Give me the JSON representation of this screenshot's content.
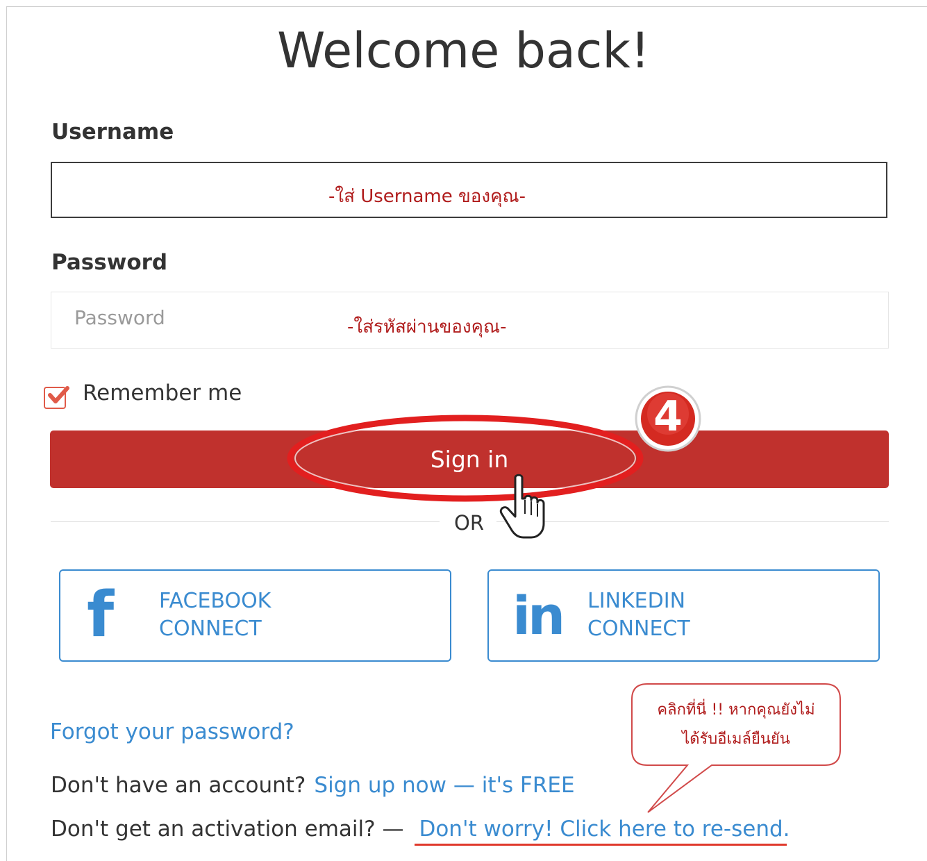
{
  "header": {
    "title": "Welcome back!"
  },
  "form": {
    "username_label": "Username",
    "username_note": "-ใส่ Username ของคุณ-",
    "password_label": "Password",
    "password_placeholder": "Password",
    "password_note": "-ใส่รหัสผ่านของคุณ-",
    "remember_label": "Remember me",
    "remember_checked": true,
    "signin_label": "Sign in",
    "or_label": "OR"
  },
  "social": {
    "facebook": {
      "icon": "facebook-icon",
      "line1": "FACEBOOK",
      "line2": "CONNECT"
    },
    "linkedin": {
      "icon": "linkedin-icon",
      "line1": "LINKEDIN",
      "line2": "CONNECT"
    }
  },
  "links": {
    "forgot": "Forgot your password?",
    "signup_prompt": "Don't have an account?",
    "signup_link": "Sign up now — it's FREE",
    "activation_prompt": "Don't get an activation email? —",
    "activation_link": "Don't worry! Click here to re-send."
  },
  "annotation": {
    "step_badge": "4",
    "bubble_line1": "คลิกที่นี่ !! หากคุณยังไม่",
    "bubble_line2": "ได้รับอีเมล์ยืนยัน"
  },
  "colors": {
    "primary_red": "#c0312d",
    "link_blue": "#3a8bd0",
    "note_red": "#b01c1c"
  }
}
